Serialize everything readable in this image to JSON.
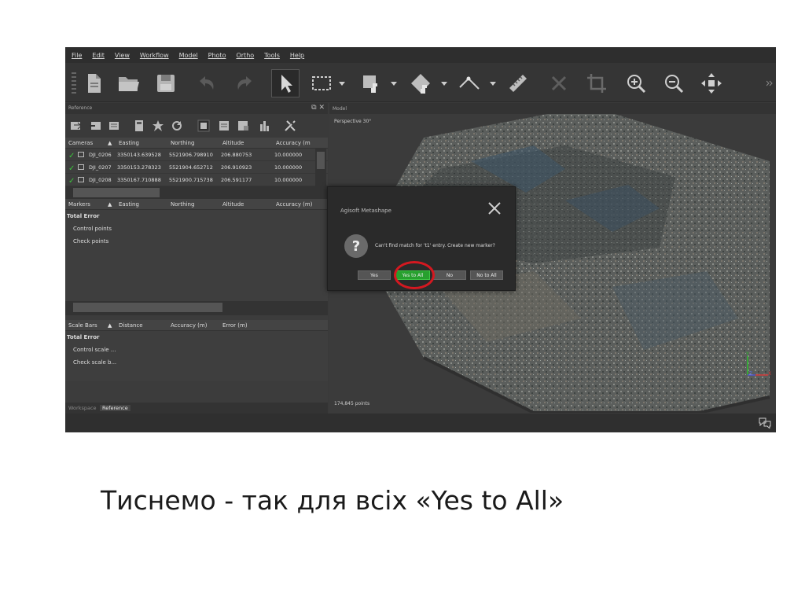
{
  "menu": [
    "File",
    "Edit",
    "View",
    "Workflow",
    "Model",
    "Photo",
    "Ortho",
    "Tools",
    "Help"
  ],
  "reference_panel": {
    "title": "Reference",
    "cameras_table": {
      "headers": [
        "Cameras",
        "Easting",
        "Northing",
        "Altitude",
        "Accuracy (m"
      ],
      "rows": [
        {
          "name": "DJI_0206",
          "easting": "3350143.639528",
          "northing": "5521906.798910",
          "altitude": "206.880753",
          "accuracy": "10.000000"
        },
        {
          "name": "DJI_0207",
          "easting": "3350153.278323",
          "northing": "5521904.652712",
          "altitude": "206.910923",
          "accuracy": "10.000000"
        },
        {
          "name": "DJI_0208",
          "easting": "3350167.710888",
          "northing": "5521900.715738",
          "altitude": "206.591177",
          "accuracy": "10.000000"
        }
      ]
    },
    "markers_table": {
      "headers": [
        "Markers",
        "Easting",
        "Northing",
        "Altitude",
        "Accuracy (m)"
      ],
      "rows": [
        "Total Error",
        "Control points",
        "Check points"
      ]
    },
    "scalebars_table": {
      "headers": [
        "Scale Bars",
        "Distance",
        "Accuracy (m)",
        "Error (m)"
      ],
      "rows": [
        "Total Error",
        "Control scale ...",
        "Check scale b..."
      ]
    },
    "tabs": [
      "Workspace",
      "Reference"
    ]
  },
  "viewport": {
    "title": "Model",
    "perspective": "Perspective 30°",
    "points": "174,845 points",
    "axis_labels": {
      "y": "Y",
      "z": "Z",
      "x": "X"
    }
  },
  "dialog": {
    "title": "Agisoft Metashape",
    "message": "Can't find match for 't1' entry. Create new marker?",
    "buttons": [
      "Yes",
      "Yes to All",
      "No",
      "No to All"
    ]
  },
  "caption": "Тиснемо  - так для всіх «Yes to All»",
  "colors": {
    "accent_green": "#27a02e",
    "highlight_red": "#d41820"
  },
  "toolbar_icons": [
    "new-document-icon",
    "open-folder-icon",
    "save-icon",
    "undo-icon",
    "redo-icon",
    "navigate-cursor-icon",
    "rectangle-selection-icon",
    "resize-region-icon",
    "rotate-object-icon",
    "draw-polyline-icon",
    "ruler-icon",
    "delete-icon",
    "crop-icon",
    "zoom-in-icon",
    "zoom-out-icon",
    "move-object-icon"
  ]
}
